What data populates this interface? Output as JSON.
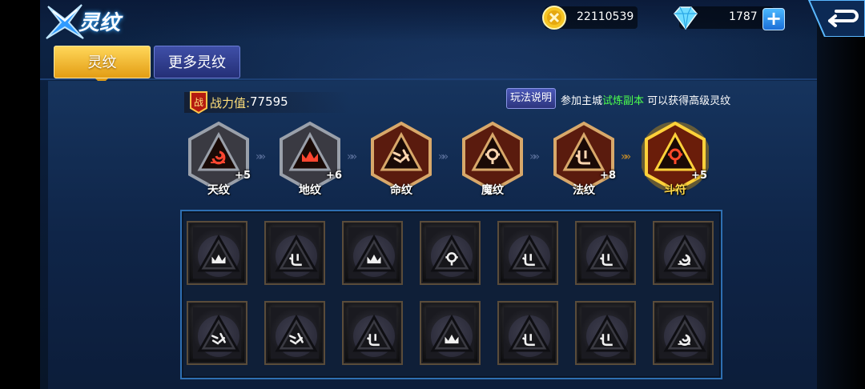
{
  "header": {
    "title": "灵纹",
    "coins": "22110539",
    "gems": "1787",
    "icons": {
      "coin": "coin-icon",
      "gem": "diamond-icon",
      "add": "plus-icon",
      "back": "back-arrow-icon"
    }
  },
  "tabs": [
    {
      "label": "灵纹",
      "active": true
    },
    {
      "label": "更多灵纹",
      "active": false
    }
  ],
  "power": {
    "badge": "战",
    "label": "战力值:",
    "value": "77595"
  },
  "info": {
    "rules_button": "玩法说明",
    "hint_prefix": "参加主城",
    "hint_highlight": "试炼副本",
    "hint_suffix": " 可以获得高级灵纹"
  },
  "slots": [
    {
      "name": "天纹",
      "level": "+5",
      "glyph": "swirl",
      "state": "silver"
    },
    {
      "name": "地纹",
      "level": "+6",
      "glyph": "crown",
      "state": "silver"
    },
    {
      "name": "命纹",
      "level": "",
      "glyph": "tally",
      "state": "bronze"
    },
    {
      "name": "魔纹",
      "level": "",
      "glyph": "orb",
      "state": "bronze"
    },
    {
      "name": "法纹",
      "level": "+8",
      "glyph": "hook",
      "state": "bronze"
    },
    {
      "name": "斗符",
      "level": "+5",
      "glyph": "orb",
      "state": "gold"
    }
  ],
  "inventory": [
    [
      "crown",
      "hook",
      "crown",
      "orb",
      "hook",
      "hook",
      "swirl"
    ],
    [
      "tally",
      "tally",
      "hook",
      "crown",
      "hook",
      "hook",
      "swirl"
    ]
  ],
  "colors": {
    "accent_gold": "#e39d14",
    "tab_blue": "#2d357e",
    "hint_green": "#4cff4c",
    "frame_blue": "#2e6fb2"
  }
}
